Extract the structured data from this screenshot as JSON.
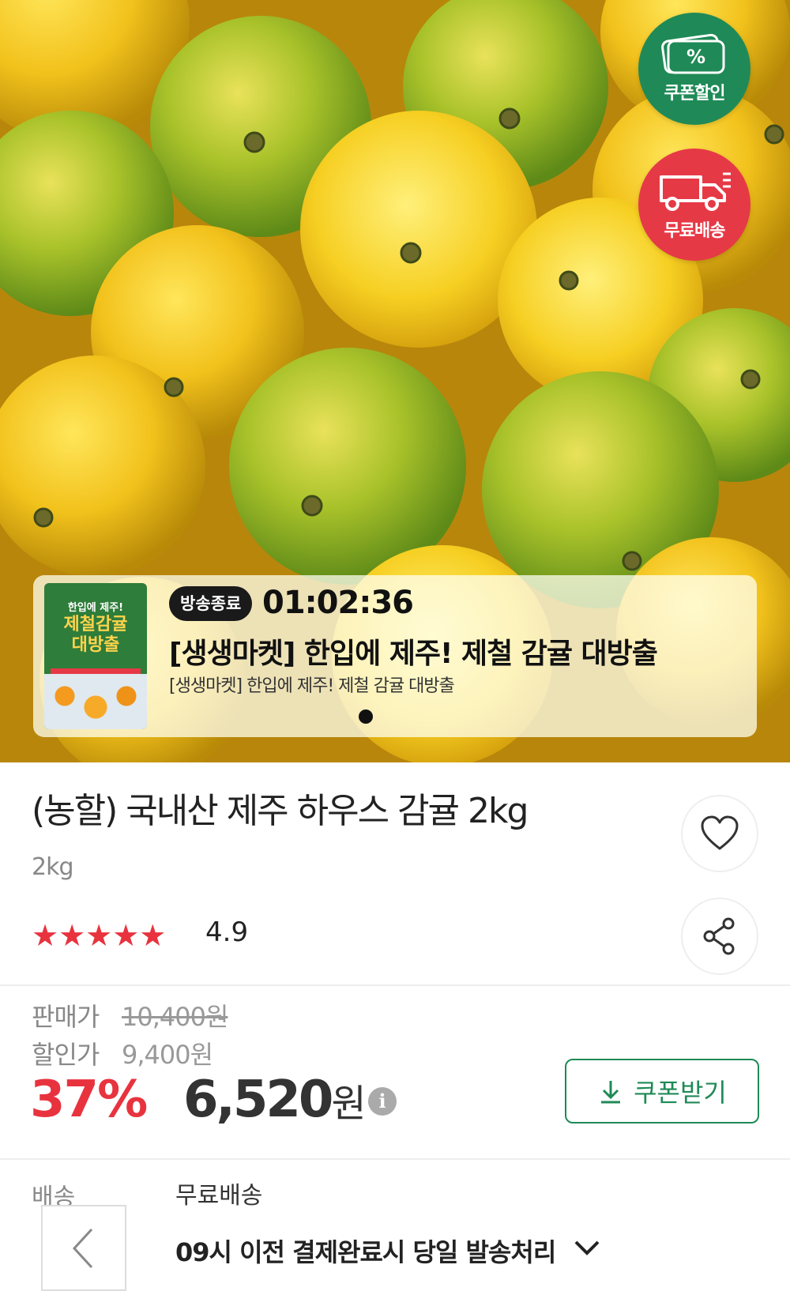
{
  "badges": {
    "coupon_label": "쿠폰할인",
    "coupon_symbol": "%",
    "shipping_label": "무료배송",
    "coupon_color": "#1f8a57",
    "shipping_color": "#e63946"
  },
  "live": {
    "thumb_line1": "한입에 제주!",
    "thumb_line2": "제철감귤",
    "thumb_line3": "대방출",
    "status": "방송종료",
    "timer": "01:02:36",
    "title": "[생생마켓] 한입에 제주! 제철 감귤 대방출",
    "subtitle": "[생생마켓] 한입에 제주! 제철 감귤 대방출"
  },
  "product": {
    "name": "(농할) 국내산 제주 하우스 감귤 2kg",
    "weight": "2kg",
    "rating": "4.9",
    "stars": "★★★★★"
  },
  "price": {
    "sale_label": "판매가",
    "original": "10,400원",
    "discount_label": "할인가",
    "discounted": "9,400원",
    "percent": "37%",
    "final_amount": "6,520",
    "final_unit": "원",
    "info_icon": "i",
    "coupon_button": "쿠폰받기"
  },
  "shipping": {
    "label": "배송",
    "free": "무료배송",
    "note": "09시 이전 결제완료시 당일 발송처리"
  },
  "colors": {
    "accent_red": "#e8333f",
    "accent_green": "#1f8a57"
  }
}
